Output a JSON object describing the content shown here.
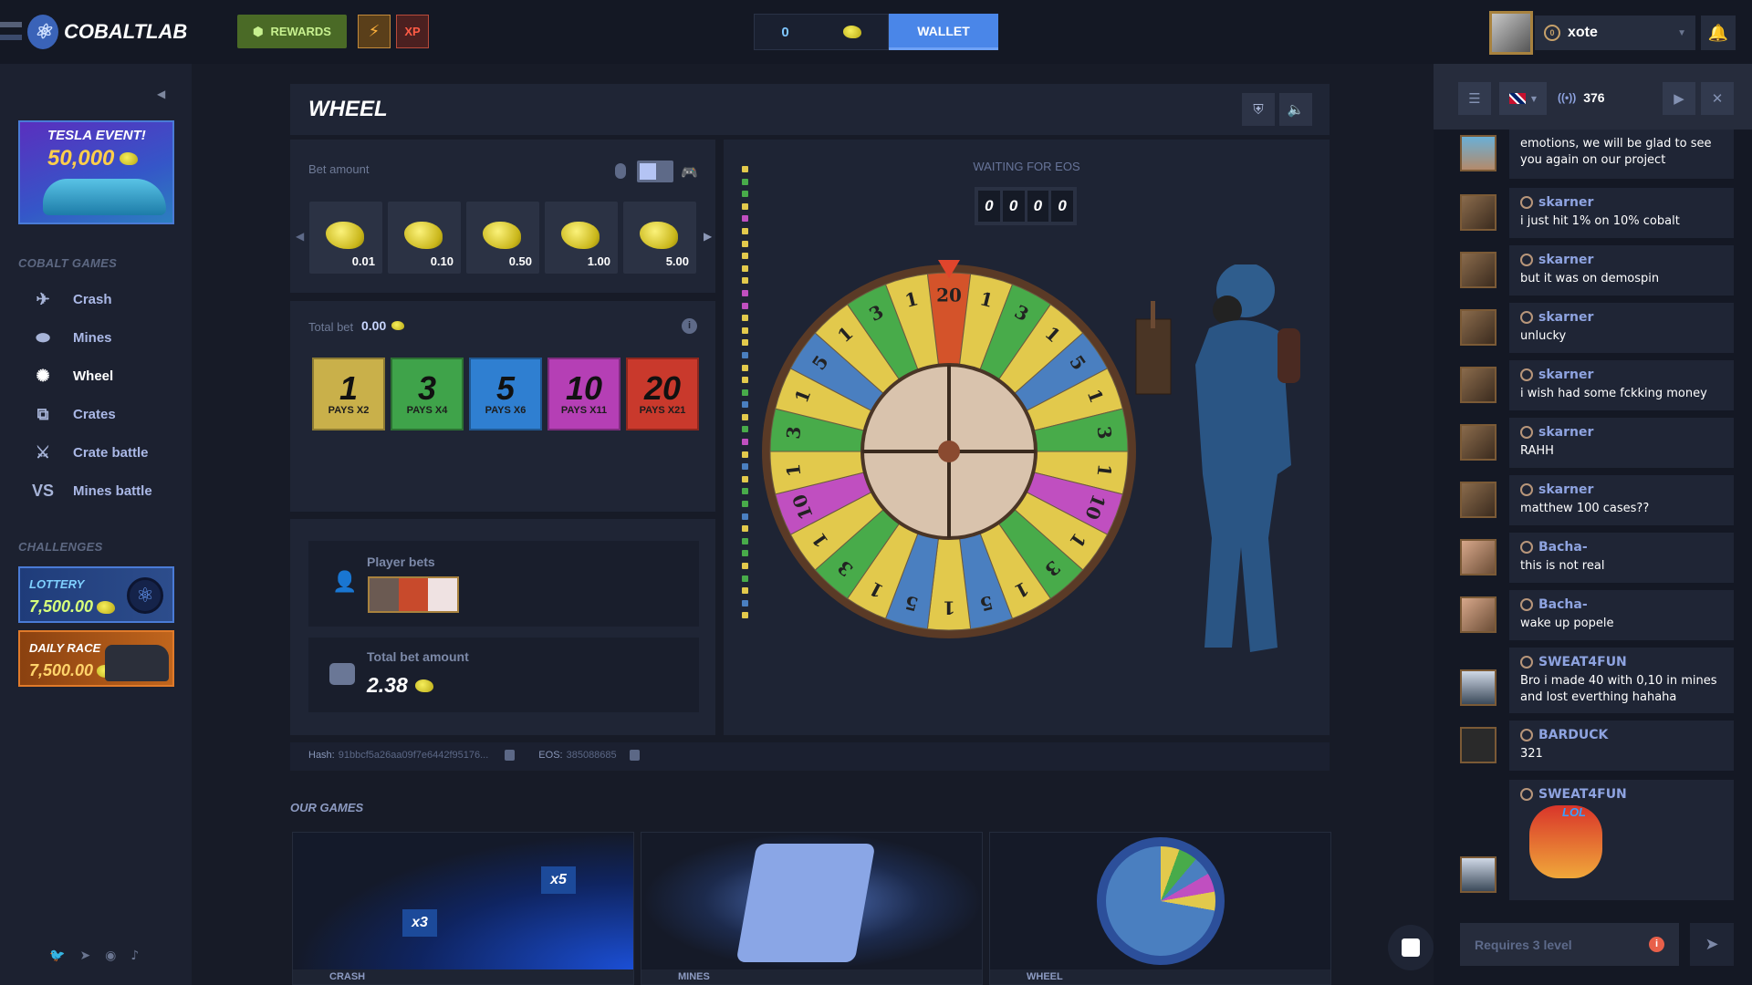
{
  "header": {
    "brand": "COBALTLAB",
    "rewards_label": "REWARDS",
    "xp_label": "XP",
    "balance": "0",
    "wallet_label": "WALLET",
    "username": "xote"
  },
  "sidebar": {
    "banner": {
      "title": "TESLA EVENT!",
      "amount": "50,000"
    },
    "games_title": "COBALT GAMES",
    "games": [
      {
        "label": "Crash",
        "icon": "gyrocopter-icon"
      },
      {
        "label": "Mines",
        "icon": "landmine-icon"
      },
      {
        "label": "Wheel",
        "icon": "wheel-icon",
        "active": true
      },
      {
        "label": "Crates",
        "icon": "crate-icon"
      },
      {
        "label": "Crate battle",
        "icon": "crossed-swords-icon"
      },
      {
        "label": "Mines battle",
        "icon": "versus-icon"
      }
    ],
    "challenges_title": "CHALLENGES",
    "challenges": [
      {
        "name": "LOTTERY",
        "amount": "7,500.00"
      },
      {
        "name": "DAILY RACE",
        "amount": "7,500.00"
      }
    ]
  },
  "game": {
    "title": "WHEEL",
    "bet_amount_label": "Bet amount",
    "chips": [
      "0.01",
      "0.10",
      "0.50",
      "1.00",
      "5.00"
    ],
    "total_bet_label": "Total bet",
    "total_bet": "0.00",
    "multipliers": [
      {
        "value": "1",
        "pays": "PAYS X2",
        "color": "#c9b04a"
      },
      {
        "value": "3",
        "pays": "PAYS X4",
        "color": "#3fa34a"
      },
      {
        "value": "5",
        "pays": "PAYS X6",
        "color": "#2f7fd1"
      },
      {
        "value": "10",
        "pays": "PAYS X11",
        "color": "#b53fb5"
      },
      {
        "value": "20",
        "pays": "PAYS X21",
        "color": "#c9392c"
      }
    ],
    "player_bets_label": "Player bets",
    "total_bet_amount_label": "Total bet amount",
    "total_bet_amount": "2.38",
    "status": "WAITING FOR EOS",
    "timer": [
      "0",
      "0",
      "0",
      "0"
    ],
    "hash_label": "Hash:",
    "hash": "91bbcf5a26aa09f7e6442f95176...",
    "eos_label": "EOS:",
    "eos": "385088685",
    "segment_colors": {
      "1": "#e2c94c",
      "3": "#48ab4a",
      "5": "#4a7fc0",
      "10": "#c04fc0",
      "20": "#d4532a"
    },
    "wheel_segments": [
      "20",
      "1",
      "3",
      "1",
      "5",
      "1",
      "3",
      "1",
      "10",
      "1",
      "3",
      "1",
      "5",
      "1",
      "5",
      "1",
      "3",
      "1",
      "10",
      "1",
      "3",
      "1",
      "5",
      "1",
      "3",
      "1"
    ],
    "history": [
      "1",
      "3",
      "3",
      "1",
      "10",
      "1",
      "1",
      "1",
      "1",
      "1",
      "10",
      "10",
      "1",
      "1",
      "1",
      "5",
      "1",
      "1",
      "3",
      "5",
      "1",
      "3",
      "10",
      "1",
      "5",
      "1",
      "3",
      "3",
      "5",
      "1",
      "3",
      "3",
      "1",
      "3",
      "1",
      "5",
      "1"
    ]
  },
  "our_games": {
    "title": "OUR GAMES",
    "cards": [
      {
        "label": "CRASH",
        "badges": [
          "x3",
          "x5"
        ]
      },
      {
        "label": "MINES"
      },
      {
        "label": "WHEEL"
      }
    ]
  },
  "chat": {
    "online": "376",
    "messages": [
      {
        "user": "",
        "text": "emotions, we will be glad to see you again on our project"
      },
      {
        "user": "skarner",
        "text": "i just hit 1% on 10% cobalt"
      },
      {
        "user": "skarner",
        "text": "but it was on demospin"
      },
      {
        "user": "skarner",
        "text": "unlucky"
      },
      {
        "user": "skarner",
        "text": "i wish had some fckking money"
      },
      {
        "user": "skarner",
        "text": "RAHH"
      },
      {
        "user": "skarner",
        "text": "matthew 100 cases??"
      },
      {
        "user": "Bacha-",
        "text": "this is not real"
      },
      {
        "user": "Bacha-",
        "text": "wake up popele"
      },
      {
        "user": "SWEAT4FUN",
        "text": "Bro i made 40 with 0,10 in mines and lost everthing hahaha"
      },
      {
        "user": "BARDUCK",
        "text": "321"
      },
      {
        "user": "SWEAT4FUN",
        "text": "",
        "sticker": "LOL"
      }
    ],
    "input_placeholder": "Requires 3 level"
  }
}
